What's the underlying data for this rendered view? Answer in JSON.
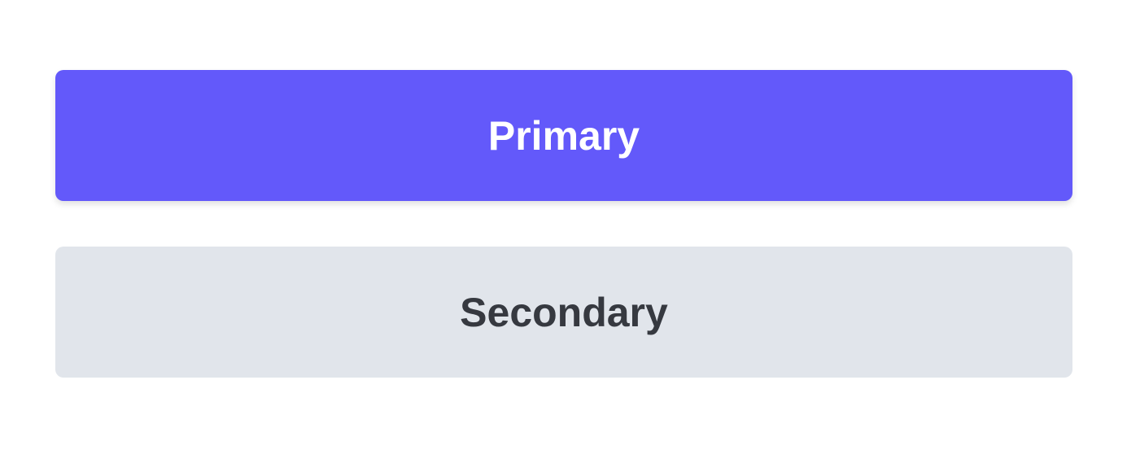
{
  "buttons": {
    "primary": {
      "label": "Primary",
      "color": "#6359fa",
      "text_color": "#ffffff"
    },
    "secondary": {
      "label": "Secondary",
      "color": "#e1e5eb",
      "text_color": "#363940"
    }
  }
}
